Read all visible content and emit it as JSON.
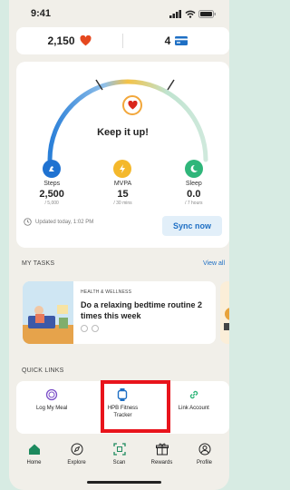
{
  "status": {
    "time": "9:41"
  },
  "points": {
    "hearts": "2,150",
    "cards": "4",
    "heart_color": "#e5481f",
    "card_color": "#1e6fc4"
  },
  "activity": {
    "headline": "Keep it up!",
    "metrics": [
      {
        "label": "Steps",
        "value": "2,500",
        "target": "/ 5,000",
        "color": "#1f72d1",
        "icon": "shoe-icon"
      },
      {
        "label": "MVPA",
        "value": "15",
        "target": "/ 30 mins",
        "color": "#f4b82b",
        "icon": "lightning-icon"
      },
      {
        "label": "Sleep",
        "value": "0.0",
        "target": "/ 7 hours",
        "color": "#2fb67a",
        "icon": "moon-icon"
      }
    ],
    "updated": "Updated today, 1:02 PM",
    "sync_label": "Sync now"
  },
  "tasks": {
    "section_title": "MY TASKS",
    "view_all": "View all",
    "card": {
      "category": "HEALTH & WELLNESS",
      "title": "Do a relaxing bedtime routine 2 times this week"
    }
  },
  "quick_links": {
    "section_title": "QUICK LINKS",
    "items": [
      {
        "label": "Log My Meal",
        "icon": "plate-icon"
      },
      {
        "label": "HPB Fitness Tracker",
        "icon": "watch-icon"
      },
      {
        "label": "Link Account",
        "icon": "link-icon"
      }
    ]
  },
  "nav": {
    "items": [
      {
        "label": "Home",
        "icon": "home-icon"
      },
      {
        "label": "Explore",
        "icon": "compass-icon"
      },
      {
        "label": "Scan",
        "icon": "scan-icon"
      },
      {
        "label": "Rewards",
        "icon": "gift-icon"
      },
      {
        "label": "Profile",
        "icon": "profile-icon"
      }
    ]
  }
}
